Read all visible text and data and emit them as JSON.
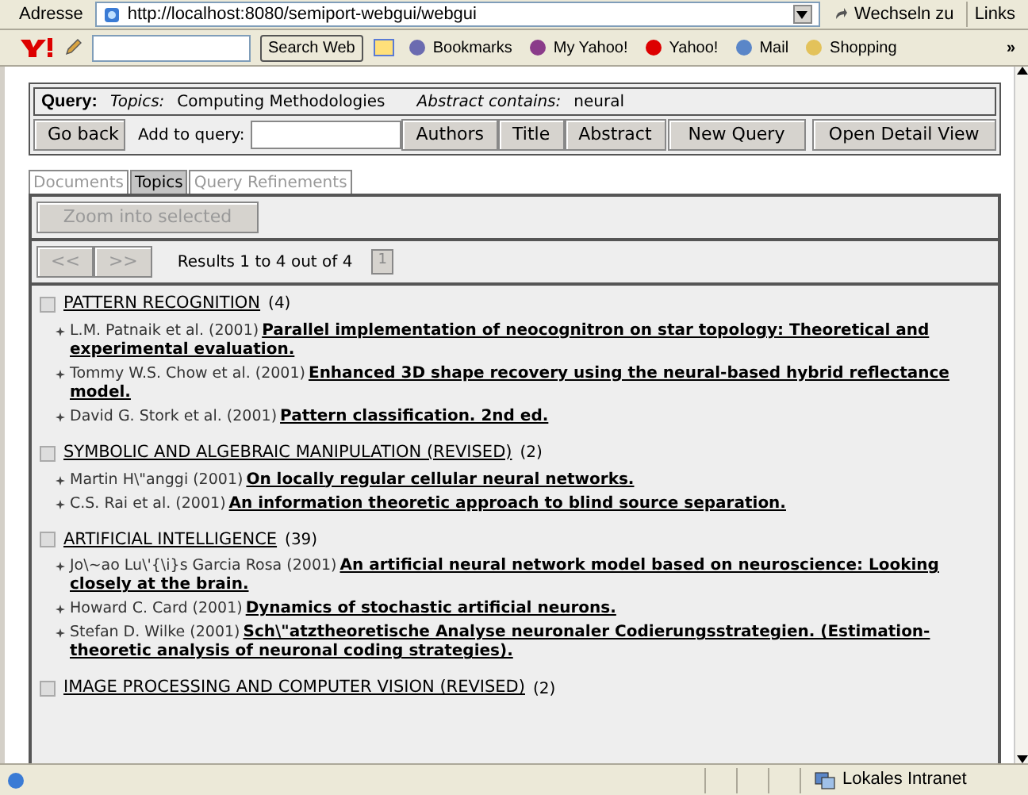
{
  "address_bar": {
    "label": "Adresse",
    "url": "http://localhost:8080/semiport-webgui/webgui",
    "go": "Wechseln zu",
    "links": "Links"
  },
  "toolbar": {
    "search_button": "Search Web",
    "items": [
      "Bookmarks",
      "My Yahoo!",
      "Yahoo!",
      "Mail",
      "Shopping"
    ],
    "more": "»"
  },
  "query": {
    "label": "Query:",
    "parts": [
      {
        "key": "Topics:",
        "value": "Computing Methodologies"
      },
      {
        "key": "Abstract contains:",
        "value": "neural"
      }
    ]
  },
  "actions": {
    "back": "Go back",
    "add_label": "Add to query:",
    "buttons": [
      "Authors",
      "Title",
      "Abstract",
      "New Query",
      "Open Detail View"
    ]
  },
  "tabs": [
    {
      "label": "Documents",
      "selected": false
    },
    {
      "label": "Topics",
      "selected": true
    },
    {
      "label": "Query Refinements",
      "selected": false
    }
  ],
  "zoom_button": {
    "label": "Zoom into selected",
    "disabled": true
  },
  "pager": {
    "prev": "<<",
    "next": ">>",
    "disabled": true,
    "summary": "Results 1 to 4 out of 4",
    "page": "1"
  },
  "topics": [
    {
      "title": "PATTERN RECOGNITION",
      "count": "(4)",
      "checked": false,
      "documents": [
        {
          "authors": "L.M. Patnaik et al. (2001)",
          "title": "Parallel implementation of neocognitron on star topology: Theoretical and experimental evaluation."
        },
        {
          "authors": "Tommy W.S. Chow et al. (2001)",
          "title": "Enhanced 3D shape recovery using the neural-based hybrid reflectance model."
        },
        {
          "authors": "David G. Stork et al. (2001)",
          "title": "Pattern classification. 2nd ed."
        }
      ]
    },
    {
      "title": "SYMBOLIC AND ALGEBRAIC MANIPULATION (REVISED)",
      "count": "(2)",
      "checked": false,
      "documents": [
        {
          "authors": "Martin H\\\"anggi (2001)",
          "title": "On locally regular cellular neural networks."
        },
        {
          "authors": "C.S. Rai et al. (2001)",
          "title": "An information theoretic approach to blind source separation."
        }
      ]
    },
    {
      "title": "ARTIFICIAL INTELLIGENCE",
      "count": "(39)",
      "checked": false,
      "documents": [
        {
          "authors": "Jo\\~ao Lu\\'{\\i}s Garcia Rosa (2001)",
          "title": "An artificial neural network model based on neuroscience: Looking closely at the brain."
        },
        {
          "authors": "Howard C. Card (2001)",
          "title": "Dynamics of stochastic artificial neurons."
        },
        {
          "authors": "Stefan D. Wilke (2001)",
          "title": "Sch\\\"atztheoretische Analyse neuronaler Codierungsstrategien. (Estimation-theoretic analysis of neuronal coding strategies)."
        }
      ]
    },
    {
      "title": "IMAGE PROCESSING AND COMPUTER VISION (REVISED)",
      "count": "(2)",
      "checked": false
    }
  ],
  "status_bar": {
    "zone": "Lokales Intranet"
  }
}
